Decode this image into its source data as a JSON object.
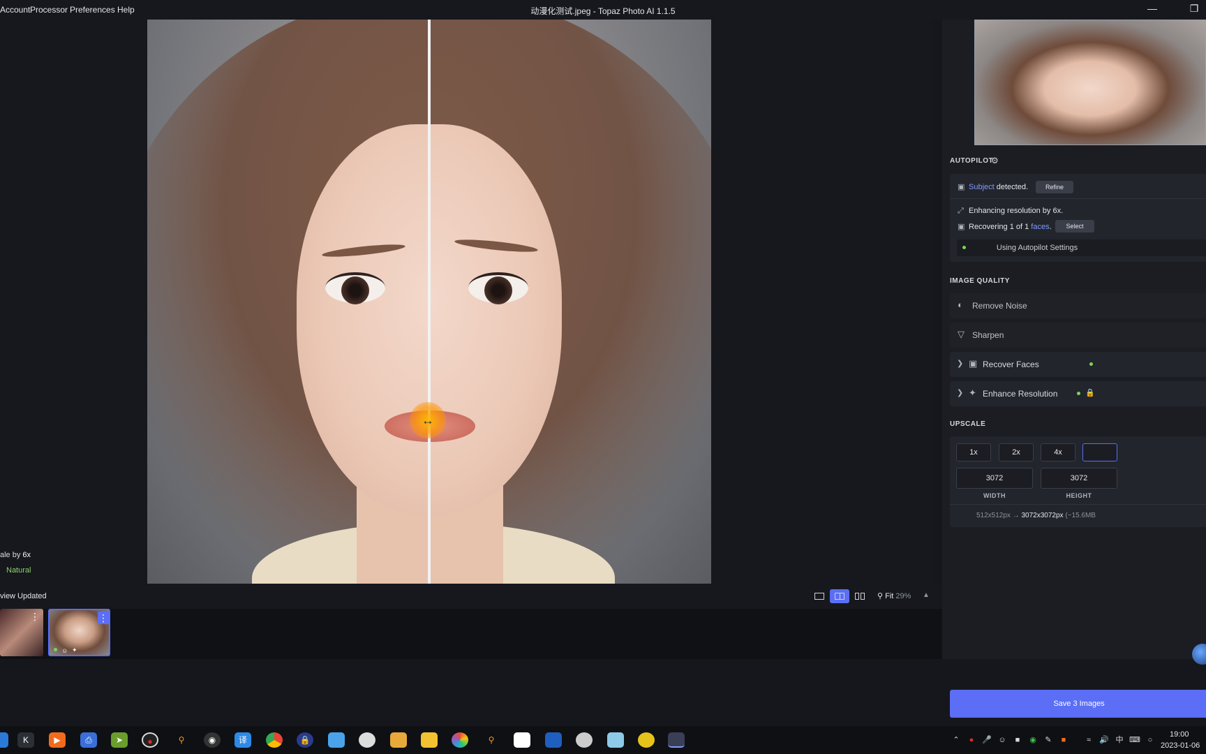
{
  "window": {
    "title": "动漫化测试.jpeg - Topaz Photo AI 1.1.5",
    "menu": [
      "Account",
      "Processor",
      "Preferences",
      "Help"
    ]
  },
  "canvas": {
    "upscale_note_prefix": "ale by ",
    "upscale_note_value": "6x",
    "model_note": "Natural"
  },
  "bottom_bar": {
    "preview_status": "view Updated",
    "view_modes": [
      {
        "name": "single-view",
        "active": false
      },
      {
        "name": "split-view",
        "active": true
      },
      {
        "name": "side-by-side-view",
        "active": false
      }
    ],
    "zoom_label": "Fit",
    "zoom_value": "29%"
  },
  "filmstrip": {
    "items": [
      {
        "name": "portrait-1",
        "selected": false
      },
      {
        "name": "portrait-2",
        "selected": true
      }
    ]
  },
  "autopilot": {
    "title": "AUTOPILOT",
    "subject_link": "Subject",
    "subject_text": " detected.",
    "refine_label": "Refine",
    "enhancing_text": "Enhancing resolution by 6x.",
    "recovering_prefix": "Recovering 1 of 1 ",
    "recovering_link": "faces",
    "recovering_suffix": ".",
    "select_label": "Select",
    "settings_status": "Using Autopilot Settings"
  },
  "image_quality": {
    "title": "IMAGE QUALITY",
    "filters": [
      {
        "label": "Remove Noise",
        "enabled": false
      },
      {
        "label": "Sharpen",
        "enabled": false
      },
      {
        "label": "Recover Faces",
        "enabled": true
      },
      {
        "label": "Enhance Resolution",
        "enabled": true
      }
    ]
  },
  "upscale": {
    "title": "UPSCALE",
    "scales": [
      "1x",
      "2x",
      "4x"
    ],
    "width_value": "3072",
    "height_value": "3072",
    "width_label": "WIDTH",
    "height_label": "HEIGHT",
    "size_from": "512x512px",
    "arrow": "→",
    "size_to": "3072x3072px",
    "size_note": "(~15.6MB"
  },
  "save_label": "Save 3 Images",
  "taskbar": {
    "time": "19:00",
    "date": "2023-01-06",
    "ime": "中"
  },
  "colors": {
    "accent": "#5b6ef5",
    "active_dot": "#7cd35c",
    "link": "#7f9cff"
  }
}
